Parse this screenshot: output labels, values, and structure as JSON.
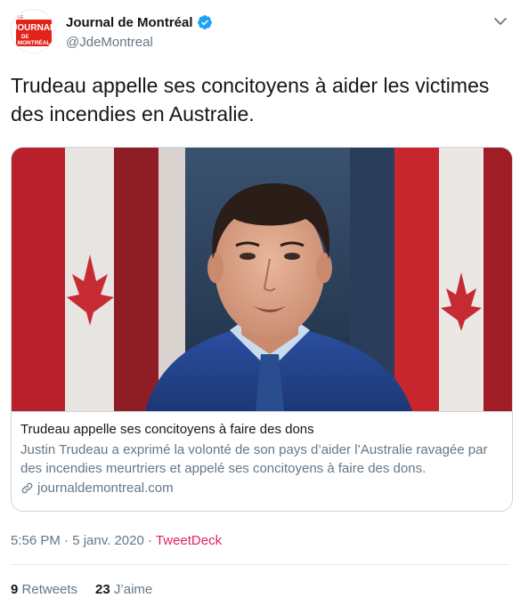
{
  "header": {
    "display_name": "Journal de Montréal",
    "handle": "@JdeMontreal",
    "avatar_logo": {
      "small_text": "LE",
      "line1": "JOURNAL",
      "line2": "DE",
      "line3": "MONTRÉAL",
      "color": "#e2231a"
    },
    "verified_icon": "verified-badge-icon",
    "menu_icon": "chevron-down-icon"
  },
  "tweet": {
    "text": "Trudeau appelle ses concitoyens à aider les victimes des incendies en Australie."
  },
  "card": {
    "title": "Trudeau appelle ses concitoyens à faire des dons",
    "description": "Justin Trudeau a exprimé la volonté de son pays d’aider l’Australie ravagée par des incendies meurtriers et appelé ses concitoyens à faire des dons.",
    "domain": "journaldemontreal.com",
    "domain_icon": "link-icon"
  },
  "meta": {
    "time": "5:56 PM",
    "separator1": " · ",
    "date": "5 janv. 2020",
    "separator2": " · ",
    "source": "TweetDeck"
  },
  "stats": {
    "retweets_count": "9",
    "retweets_label": "Retweets",
    "likes_count": "23",
    "likes_label": "J’aime"
  },
  "colors": {
    "accent_blue": "#1da1f2",
    "source_pink": "#e0245e",
    "muted_text": "#657786",
    "border": "#ccd6dd"
  }
}
